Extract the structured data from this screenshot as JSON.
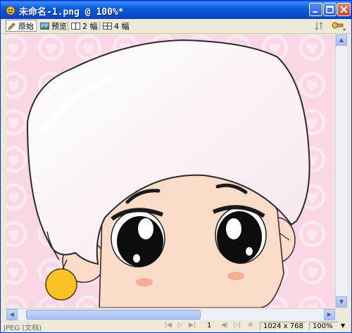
{
  "window": {
    "title": "未命名-1.png @ 100%*",
    "accent": "#0a5ce0"
  },
  "toolbar": {
    "tabs": [
      {
        "label": "原始",
        "icon": "pencil-icon",
        "active": true
      },
      {
        "label": "预览",
        "icon": "preview-icon",
        "active": false
      },
      {
        "label": "2 幅",
        "icon": "two-up-icon",
        "active": false
      },
      {
        "label": "4 幅",
        "icon": "four-up-icon",
        "active": false
      }
    ]
  },
  "status": {
    "format": "JPEG (文档)",
    "frame": "1",
    "dimensions": "1024 x 768",
    "zoom": "100%"
  },
  "canvas": {
    "bg_color": "#f9d7e4",
    "pattern_color": "#fbe6ee"
  }
}
